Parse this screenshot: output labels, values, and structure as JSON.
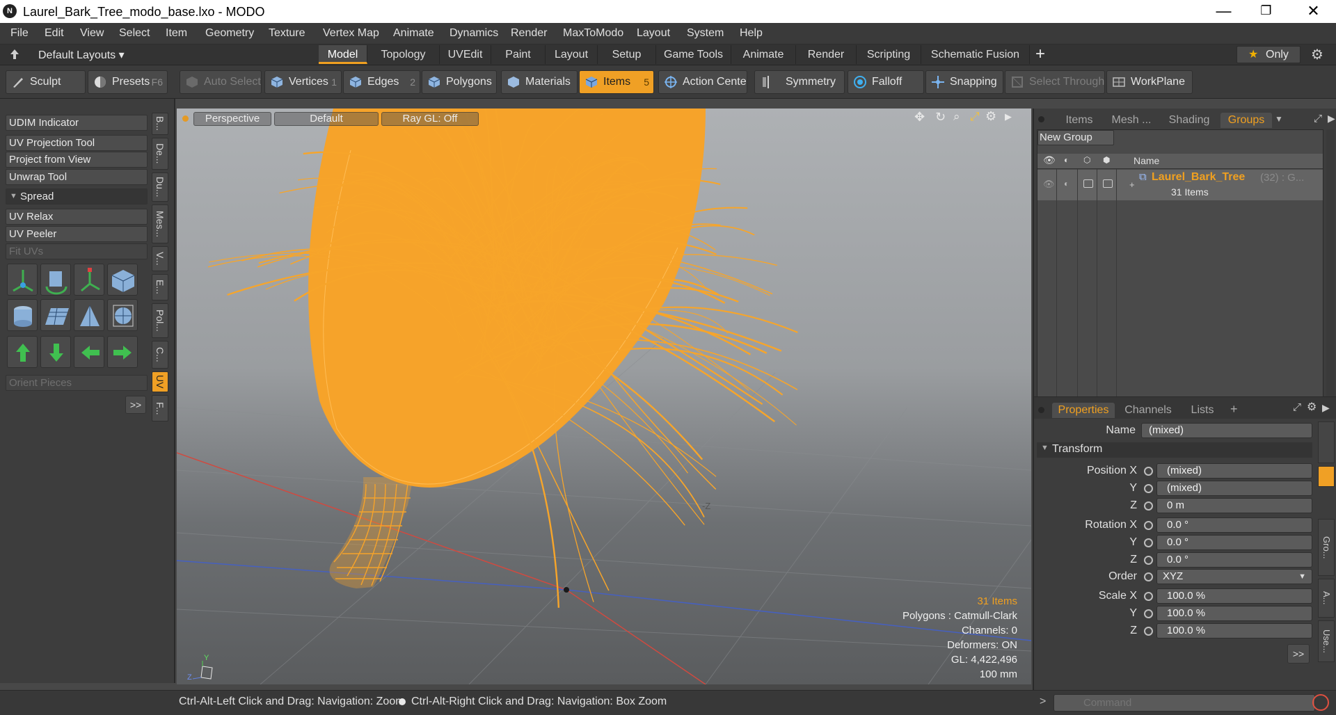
{
  "window": {
    "title": "Laurel_Bark_Tree_modo_base.lxo - MODO",
    "app_icon": "N",
    "minimize": "—",
    "restore": "❐",
    "close": "✕"
  },
  "menu": [
    "File",
    "Edit",
    "View",
    "Select",
    "Item",
    "Geometry",
    "Texture",
    "Vertex Map",
    "Animate",
    "Dynamics",
    "Render",
    "MaxToModo",
    "Layout",
    "System",
    "Help"
  ],
  "layoutbar": {
    "layouts_label": "Default Layouts",
    "tabs": [
      "Model",
      "Topology",
      "UVEdit",
      "Paint",
      "Layout",
      "Setup",
      "Game Tools",
      "Animate",
      "Render",
      "Scripting",
      "Schematic Fusion"
    ],
    "active_tab": "Model",
    "add": "+",
    "only_label": "Only"
  },
  "toolbar": {
    "sculpt": "Sculpt",
    "presets": "Presets",
    "presets_key": "F6",
    "auto_select": "Auto Select",
    "vertices": "Vertices",
    "vertices_key": "1",
    "edges": "Edges",
    "edges_key": "2",
    "polygons": "Polygons",
    "materials": "Materials",
    "items": "Items",
    "items_key": "5",
    "action_center": "Action Center",
    "symmetry": "Symmetry",
    "falloff": "Falloff",
    "snapping": "Snapping",
    "select_through": "Select Through",
    "workplane": "WorkPlane"
  },
  "leftpanel": {
    "buttons": [
      "UDIM Indicator",
      "UV Projection Tool",
      "Project from View",
      "Unwrap Tool"
    ],
    "spread": "Spread",
    "buttons2": [
      "UV Relax",
      "UV Peeler",
      "Fit UVs"
    ],
    "orient": "Orient Pieces",
    "more": ">>",
    "vtabs": [
      "B...",
      "De...",
      "Du...",
      "Mes...",
      "V...",
      "E...",
      "Pol...",
      "C...",
      "UV",
      "F..."
    ]
  },
  "viewport": {
    "view": "Perspective",
    "style": "Default",
    "raygl": "Ray GL: Off",
    "info": {
      "items": "31 Items",
      "polygons": "Polygons : Catmull-Clark",
      "channels": "Channels: 0",
      "deformers": "Deformers: ON",
      "gl": "GL: 4,422,496",
      "scale": "100 mm"
    },
    "axis_z_label": "-Z",
    "gizmo_y": "Y",
    "gizmo_z": "Z",
    "wire_color": "#f7a52a"
  },
  "statusbar": {
    "hint_left": "Ctrl-Alt-Left Click and Drag: Navigation: Zoom",
    "hint_right": "Ctrl-Alt-Right Click and Drag: Navigation: Box Zoom",
    "prompt": ">",
    "command_placeholder": "Command"
  },
  "groups_panel": {
    "tabs": [
      "Items",
      "Mesh ...",
      "Shading",
      "Groups"
    ],
    "active_tab": "Groups",
    "new_group": "New Group",
    "col_name": "Name",
    "row_name": "Laurel_Bark_Tree",
    "row_suffix": "(32) : G...",
    "row_sub": "31 Items"
  },
  "properties_panel": {
    "tabs": [
      "Properties",
      "Channels",
      "Lists"
    ],
    "active_tab": "Properties",
    "add": "+",
    "name_label": "Name",
    "name_value": "(mixed)",
    "transform": "Transform",
    "labels": {
      "position": "Position X",
      "rotation": "Rotation X",
      "scale": "Scale X",
      "y": "Y",
      "z": "Z",
      "order": "Order"
    },
    "position": [
      "(mixed)",
      "(mixed)",
      "0 m"
    ],
    "rotation": [
      "0.0 °",
      "0.0 °",
      "0.0 °"
    ],
    "order": "XYZ",
    "scale": [
      "100.0 %",
      "100.0 %",
      "100.0 %"
    ],
    "more": ">>",
    "side_tabs": [
      "Gro...",
      "A...",
      "Use..."
    ]
  },
  "colors": {
    "accent": "#f0a020",
    "panel": "#3d3d3d"
  }
}
